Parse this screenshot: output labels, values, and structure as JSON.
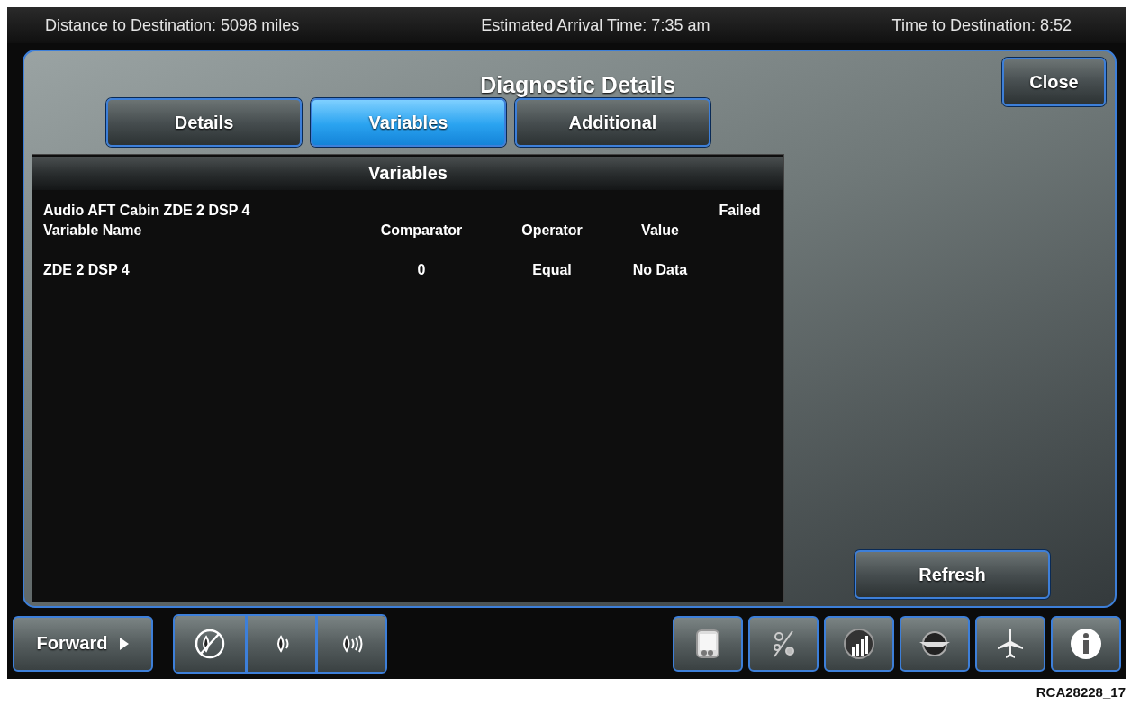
{
  "top_bar": [
    "Distance to Destination: 5098 miles",
    "Estimated Arrival Time: 7:35 am",
    "Time to Destination: 8:52"
  ],
  "title": "Diagnostic Details",
  "close_button": "Close",
  "tabs": [
    {
      "label": "Details",
      "selected": false
    },
    {
      "label": "Variables",
      "selected": true
    },
    {
      "label": "Additional",
      "selected": false
    }
  ],
  "table": {
    "header": "Variables",
    "group": "Audio AFT Cabin ZDE 2 DSP 4",
    "status": "Failed",
    "columns": [
      "Variable Name",
      "Comparator",
      "Operator",
      "Value"
    ],
    "rows": [
      [
        "ZDE 2 DSP 4",
        "0",
        "Equal",
        "No Data"
      ]
    ]
  },
  "refresh_button": "Refresh",
  "bottom_bar": {
    "forward_button": "Forward"
  },
  "figure_label": "RCA28228_17"
}
